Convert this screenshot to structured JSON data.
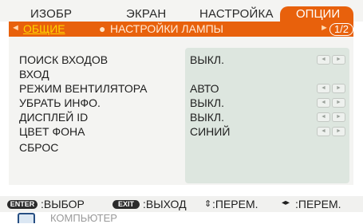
{
  "tabs": [
    {
      "label": "ИЗОБР"
    },
    {
      "label": "ЭКРАН"
    },
    {
      "label": "НАСТРОЙКА"
    },
    {
      "label": "ОПЦИИ",
      "active": true
    }
  ],
  "submenu": {
    "items": [
      {
        "label": "ОБЩИЕ",
        "active": true
      },
      {
        "label": "НАСТРОЙКИ ЛАМПЫ"
      }
    ],
    "page": "1/2"
  },
  "menu": {
    "items": [
      {
        "label": "ПОИСК ВХОДОВ",
        "value": "ВЫКЛ.",
        "adjustable": true
      },
      {
        "label": "ВХОД",
        "value": "",
        "adjustable": false
      },
      {
        "label": "РЕЖИМ ВЕНТИЛЯТОРА",
        "value": "АВТО",
        "adjustable": true
      },
      {
        "label": "УБРАТЬ ИНФО.",
        "value": "ВЫКЛ.",
        "adjustable": true
      },
      {
        "label": "ДИСПЛЕЙ ID",
        "value": "ВЫКЛ.",
        "adjustable": true
      },
      {
        "label": "ЦВЕТ ФОНА",
        "value": "СИНИЙ",
        "adjustable": true
      },
      {
        "label": "СБРОС",
        "value": "",
        "adjustable": false
      }
    ]
  },
  "help": {
    "enter_key": "ENTER",
    "enter_text": ":ВЫБОР",
    "exit_key": "EXIT",
    "exit_text": ":ВЫХОД",
    "updown_text": ":ПЕРЕМ.",
    "leftright_text": ":ПЕРЕМ."
  },
  "source": {
    "label": "КОМПЬЮТЕР",
    "icon": "monitor-icon"
  },
  "colors": {
    "accent": "#e8610c",
    "active_sub": "#ffd400",
    "panel": "#f4f4f2",
    "values_panel": "#dde6df"
  }
}
